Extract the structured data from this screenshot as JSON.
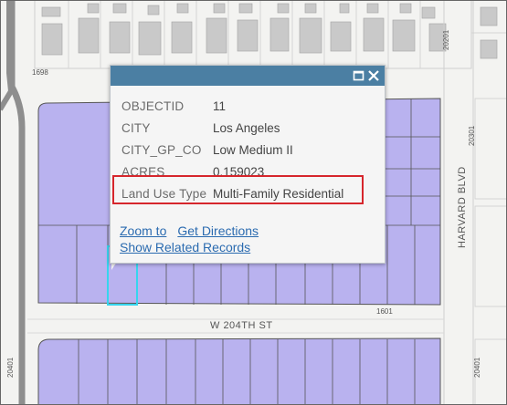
{
  "map": {
    "street_labels": {
      "w204th": "W 204TH ST",
      "harvard": "HARVARD BLVD"
    },
    "address_labels": {
      "a1698": "1698",
      "a20201": "20201",
      "a20301": "20301",
      "a1601": "1601",
      "a20401_left": "20401",
      "a20401_right": "20401"
    },
    "colors": {
      "parcel_fill": "#b9b2ef",
      "parcel_stroke": "#555555",
      "selected_stroke": "#36d5ee",
      "building": "#c9c9c9",
      "road_gray": "#909090"
    }
  },
  "popup": {
    "header_color": "#4b7fa3",
    "maximize_icon": "maximize-icon",
    "close_icon": "close-icon",
    "attributes": [
      {
        "key": "OBJECTID",
        "value": "11"
      },
      {
        "key": "CITY",
        "value": "Los Angeles"
      },
      {
        "key": "CITY_GP_CO",
        "value": "Low Medium II"
      },
      {
        "key": "ACRES",
        "value": "0.159023"
      },
      {
        "key": "Land Use Type",
        "value": "Multi-Family Residential"
      }
    ],
    "links": {
      "zoom_to": "Zoom to",
      "get_directions": "Get Directions",
      "show_related": "Show Related Records"
    },
    "highlight_color": "#d6262c"
  }
}
